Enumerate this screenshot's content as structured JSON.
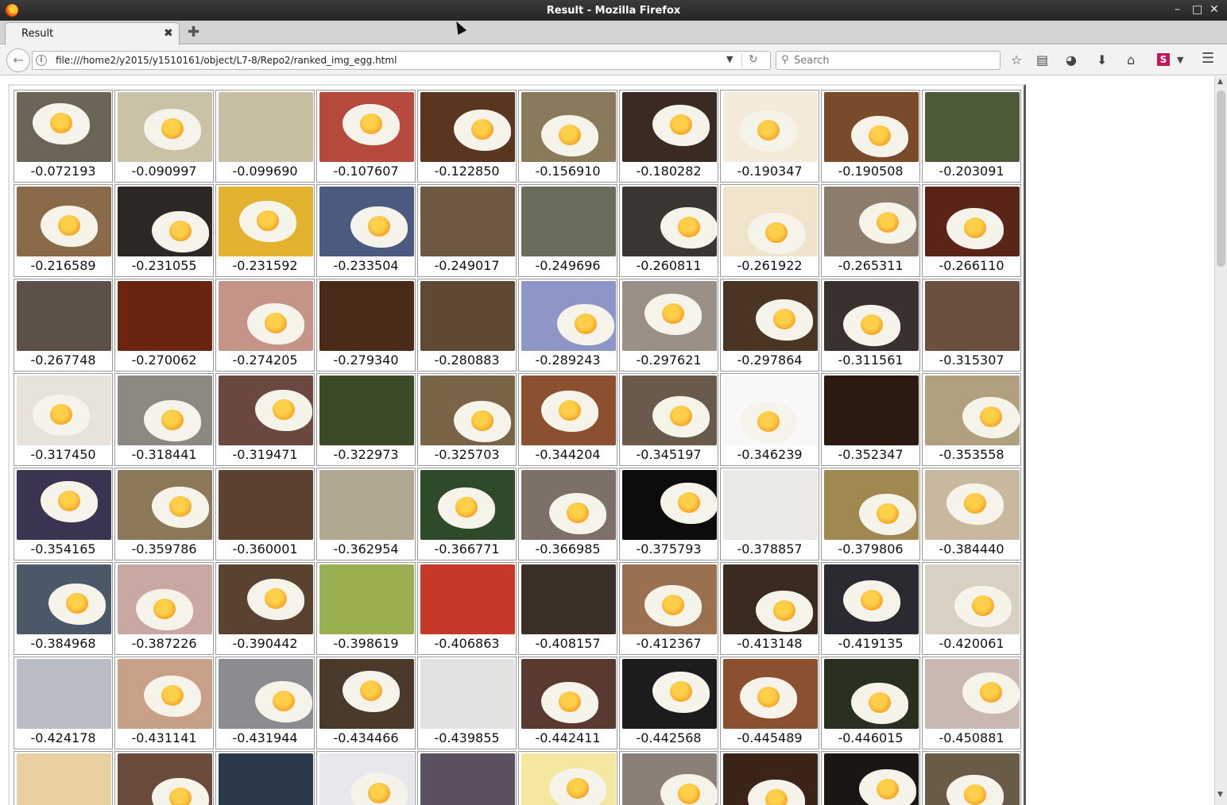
{
  "window": {
    "title": "Result - Mozilla Firefox"
  },
  "tabs": [
    {
      "label": "Result"
    }
  ],
  "toolbar": {
    "url": "file:///home2/y2015/y1510161/object/L7-8/Repo2/ranked_img_egg.html",
    "search_placeholder": "Search",
    "icons": [
      "back-icon",
      "info-icon",
      "url-dropdown-icon",
      "reload-icon",
      "search-icon",
      "bookmark-star-icon",
      "reading-list-icon",
      "pocket-icon",
      "download-icon",
      "home-icon",
      "extension-s-icon",
      "menu-icon"
    ]
  },
  "results": [
    {
      "score": "-0.072193",
      "bg": "#6b6558",
      "egg": true
    },
    {
      "score": "-0.090997",
      "bg": "#c9c2a7",
      "egg": true
    },
    {
      "score": "-0.099690",
      "bg": "#c8bea2",
      "egg": false
    },
    {
      "score": "-0.107607",
      "bg": "#b54a3c",
      "egg": true
    },
    {
      "score": "-0.122850",
      "bg": "#5a3520",
      "egg": true
    },
    {
      "score": "-0.156910",
      "bg": "#8a7a5c",
      "egg": true
    },
    {
      "score": "-0.180282",
      "bg": "#3a2a24",
      "egg": true
    },
    {
      "score": "-0.190347",
      "bg": "#f4ecd8",
      "egg": true
    },
    {
      "score": "-0.190508",
      "bg": "#7a4b2a",
      "egg": true
    },
    {
      "score": "-0.203091",
      "bg": "#4d5a3a",
      "egg": false
    },
    {
      "score": "-0.216589",
      "bg": "#8a6a48",
      "egg": true
    },
    {
      "score": "-0.231055",
      "bg": "#2c2624",
      "egg": true
    },
    {
      "score": "-0.231592",
      "bg": "#e3b330",
      "egg": true
    },
    {
      "score": "-0.233504",
      "bg": "#4c5a80",
      "egg": true
    },
    {
      "score": "-0.249017",
      "bg": "#6d5844",
      "egg": false
    },
    {
      "score": "-0.249696",
      "bg": "#6a6c5c",
      "egg": false
    },
    {
      "score": "-0.260811",
      "bg": "#3a3530",
      "egg": true
    },
    {
      "score": "-0.261922",
      "bg": "#f1e4cc",
      "egg": true
    },
    {
      "score": "-0.265311",
      "bg": "#8c7c6c",
      "egg": true
    },
    {
      "score": "-0.266110",
      "bg": "#5a2418",
      "egg": true
    },
    {
      "score": "-0.267748",
      "bg": "#5c5048",
      "egg": false
    },
    {
      "score": "-0.270062",
      "bg": "#6a2410",
      "egg": false
    },
    {
      "score": "-0.274205",
      "bg": "#c49488",
      "egg": true
    },
    {
      "score": "-0.279340",
      "bg": "#4a2a18",
      "egg": false
    },
    {
      "score": "-0.280883",
      "bg": "#5e4a34",
      "egg": false
    },
    {
      "score": "-0.289243",
      "bg": "#8e96c8",
      "egg": true
    },
    {
      "score": "-0.297621",
      "bg": "#9a9088",
      "egg": true
    },
    {
      "score": "-0.297864",
      "bg": "#4a3424",
      "egg": true
    },
    {
      "score": "-0.311561",
      "bg": "#3a3030",
      "egg": true
    },
    {
      "score": "-0.315307",
      "bg": "#6a5040",
      "egg": false
    },
    {
      "score": "-0.317450",
      "bg": "#e8e2dc",
      "egg": true
    },
    {
      "score": "-0.318441",
      "bg": "#8c8882",
      "egg": true
    },
    {
      "score": "-0.319471",
      "bg": "#6a4840",
      "egg": true
    },
    {
      "score": "-0.322973",
      "bg": "#3c4a28",
      "egg": false
    },
    {
      "score": "-0.325703",
      "bg": "#7a6448",
      "egg": true
    },
    {
      "score": "-0.344204",
      "bg": "#8a5030",
      "egg": true
    },
    {
      "score": "-0.345197",
      "bg": "#6a5a4c",
      "egg": true
    },
    {
      "score": "-0.346239",
      "bg": "#f8f8f8",
      "egg": true
    },
    {
      "score": "-0.352347",
      "bg": "#2a1a10",
      "egg": false
    },
    {
      "score": "-0.353558",
      "bg": "#b0a080",
      "egg": true
    },
    {
      "score": "-0.354165",
      "bg": "#3a3450",
      "egg": true
    },
    {
      "score": "-0.359786",
      "bg": "#8a7858",
      "egg": true
    },
    {
      "score": "-0.360001",
      "bg": "#5c4030",
      "egg": false
    },
    {
      "score": "-0.362954",
      "bg": "#b0a890",
      "egg": false
    },
    {
      "score": "-0.366771",
      "bg": "#2e4a2a",
      "egg": true
    },
    {
      "score": "-0.366985",
      "bg": "#7c7068",
      "egg": true
    },
    {
      "score": "-0.375793",
      "bg": "#0c0c0c",
      "egg": true
    },
    {
      "score": "-0.378857",
      "bg": "#eceae6",
      "egg": false
    },
    {
      "score": "-0.379806",
      "bg": "#a08850",
      "egg": true
    },
    {
      "score": "-0.384440",
      "bg": "#c8b8a0",
      "egg": true
    },
    {
      "score": "-0.384968",
      "bg": "#4a5868",
      "egg": true
    },
    {
      "score": "-0.387226",
      "bg": "#c8a8a0",
      "egg": true
    },
    {
      "score": "-0.390442",
      "bg": "#5a4230",
      "egg": true
    },
    {
      "score": "-0.398619",
      "bg": "#9ab050",
      "egg": false
    },
    {
      "score": "-0.406863",
      "bg": "#c83828",
      "egg": false
    },
    {
      "score": "-0.408157",
      "bg": "#3a3028",
      "egg": false
    },
    {
      "score": "-0.412367",
      "bg": "#9a7050",
      "egg": true
    },
    {
      "score": "-0.413148",
      "bg": "#3a2a20",
      "egg": true
    },
    {
      "score": "-0.419135",
      "bg": "#2a2a30",
      "egg": true
    },
    {
      "score": "-0.420061",
      "bg": "#d8d0c0",
      "egg": true
    },
    {
      "score": "-0.424178",
      "bg": "#b8bcc4",
      "egg": false
    },
    {
      "score": "-0.431141",
      "bg": "#c8a088",
      "egg": true
    },
    {
      "score": "-0.431944",
      "bg": "#8a8c90",
      "egg": true
    },
    {
      "score": "-0.434466",
      "bg": "#4a3a2c",
      "egg": true
    },
    {
      "score": "-0.439855",
      "bg": "#e2e2e0",
      "egg": false
    },
    {
      "score": "-0.442411",
      "bg": "#5a3a30",
      "egg": true
    },
    {
      "score": "-0.442568",
      "bg": "#1c1c1c",
      "egg": true
    },
    {
      "score": "-0.445489",
      "bg": "#8a5030",
      "egg": true
    },
    {
      "score": "-0.446015",
      "bg": "#2a3020",
      "egg": true
    },
    {
      "score": "-0.450881",
      "bg": "#c8b8b0",
      "egg": true
    },
    {
      "score": "",
      "bg": "#e8d0a0",
      "egg": false
    },
    {
      "score": "",
      "bg": "#6a4a3a",
      "egg": true
    },
    {
      "score": "",
      "bg": "#2a3a4a",
      "egg": false
    },
    {
      "score": "",
      "bg": "#e8e8ec",
      "egg": true
    },
    {
      "score": "",
      "bg": "#5a5060",
      "egg": false
    },
    {
      "score": "",
      "bg": "#f4e8a0",
      "egg": true
    },
    {
      "score": "",
      "bg": "#8a8078",
      "egg": true
    },
    {
      "score": "",
      "bg": "#3a2418",
      "egg": true
    },
    {
      "score": "",
      "bg": "#1a1614",
      "egg": true
    },
    {
      "score": "",
      "bg": "#6a5a48",
      "egg": true
    }
  ]
}
